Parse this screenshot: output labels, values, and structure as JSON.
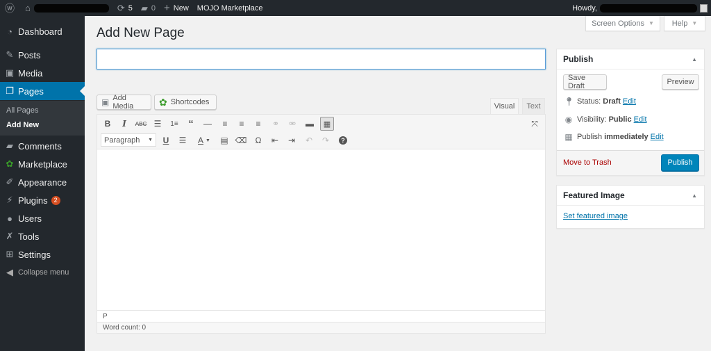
{
  "adminbar": {
    "wp_icon": "wordpress-logo-icon",
    "home_icon": "home-icon",
    "updates_count": "5",
    "comments_count": "0",
    "new_label": "New",
    "marketplace_label": "MOJO Marketplace",
    "howdy_label": "Howdy,"
  },
  "sidebar": {
    "items": [
      {
        "label": "Dashboard",
        "icon": "dashboard-icon"
      },
      {
        "label": "Posts",
        "icon": "pin-icon"
      },
      {
        "label": "Media",
        "icon": "media-icon"
      },
      {
        "label": "Pages",
        "icon": "pages-icon"
      },
      {
        "label": "Comments",
        "icon": "comment-icon"
      },
      {
        "label": "Marketplace",
        "icon": "marketplace-icon"
      },
      {
        "label": "Appearance",
        "icon": "brush-icon"
      },
      {
        "label": "Plugins",
        "icon": "plugin-icon",
        "badge": "2"
      },
      {
        "label": "Users",
        "icon": "users-icon"
      },
      {
        "label": "Tools",
        "icon": "wrench-icon"
      },
      {
        "label": "Settings",
        "icon": "settings-icon"
      }
    ],
    "submenu": [
      "All Pages",
      "Add New"
    ],
    "collapse_label": "Collapse menu"
  },
  "screen_options_label": "Screen Options",
  "help_label": "Help",
  "page_title": "Add New Page",
  "title_input": {
    "value": "",
    "placeholder": ""
  },
  "media_buttons": {
    "add_media": "Add Media",
    "shortcodes": "Shortcodes"
  },
  "editor_tabs": {
    "visual": "Visual",
    "text": "Text"
  },
  "format_select": "Paragraph",
  "path": "P",
  "word_count": "Word count: 0",
  "publish_box": {
    "title": "Publish",
    "save_draft": "Save Draft",
    "preview": "Preview",
    "status_label": "Status:",
    "status_value": "Draft",
    "visibility_label": "Visibility:",
    "visibility_value": "Public",
    "publish_label": "Publish",
    "publish_value": "immediately",
    "edit": "Edit",
    "move_to_trash": "Move to Trash",
    "publish_button": "Publish"
  },
  "featured_box": {
    "title": "Featured Image",
    "set_link": "Set featured image"
  },
  "colors": {
    "accent": "#0073aa",
    "sidebar_bg": "#23282d",
    "publish_btn": "#0085ba"
  }
}
